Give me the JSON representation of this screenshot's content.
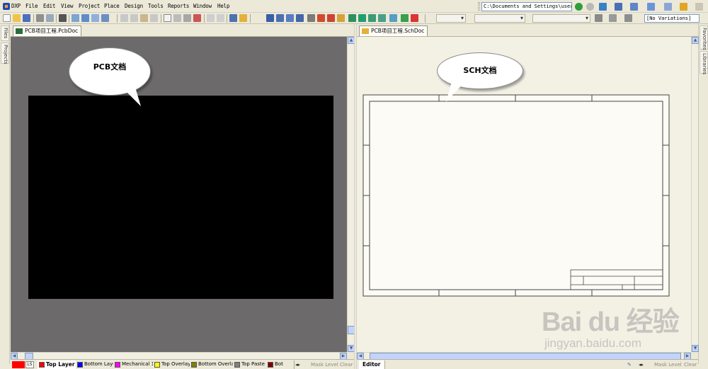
{
  "menubar": {
    "items": [
      "DXP",
      "File",
      "Edit",
      "View",
      "Project",
      "Place",
      "Design",
      "Tools",
      "Reports",
      "Window",
      "Help"
    ],
    "path": "C:\\Documents and Settings\\user\\"
  },
  "toolbar": {
    "variations": "[No Variations]"
  },
  "left_panel": {
    "tabs": [
      "Files",
      "Projects"
    ]
  },
  "right_panel": {
    "tabs": [
      "Favorites",
      "Libraries"
    ]
  },
  "pcb_pane": {
    "tab_label": "PCB项目工程.PcbDoc",
    "callout": "PCB文档",
    "canvas_bg": "#6d6a6b",
    "board_color": "#000000",
    "layer_tabs": [
      {
        "label": "LS",
        "color": "#ff0000"
      },
      {
        "label": "Top Layer",
        "color": "#ff0000"
      },
      {
        "label": "Bottom Layer",
        "color": "#0000ff"
      },
      {
        "label": "Mechanical 1",
        "color": "#ff00ff"
      },
      {
        "label": "Top Overlay",
        "color": "#ffff00"
      },
      {
        "label": "Bottom Overlay",
        "color": "#808000"
      },
      {
        "label": "Top Paste",
        "color": "#808080"
      },
      {
        "label": "Bot",
        "color": "#800000"
      }
    ],
    "mask_level": "Mask Level",
    "clear": "Clear"
  },
  "sch_pane": {
    "tab_label": "PCB项目工程.SchDoc",
    "callout": "SCH文档",
    "canvas_bg": "#f3f1e4",
    "sheet_bg": "#fdfbf5",
    "editor_tab": "Editor",
    "mask_level": "Mask Level",
    "clear": "Clear"
  },
  "watermark": {
    "brand": "Bai du 经验",
    "url": "jingyan.baidu.com"
  }
}
